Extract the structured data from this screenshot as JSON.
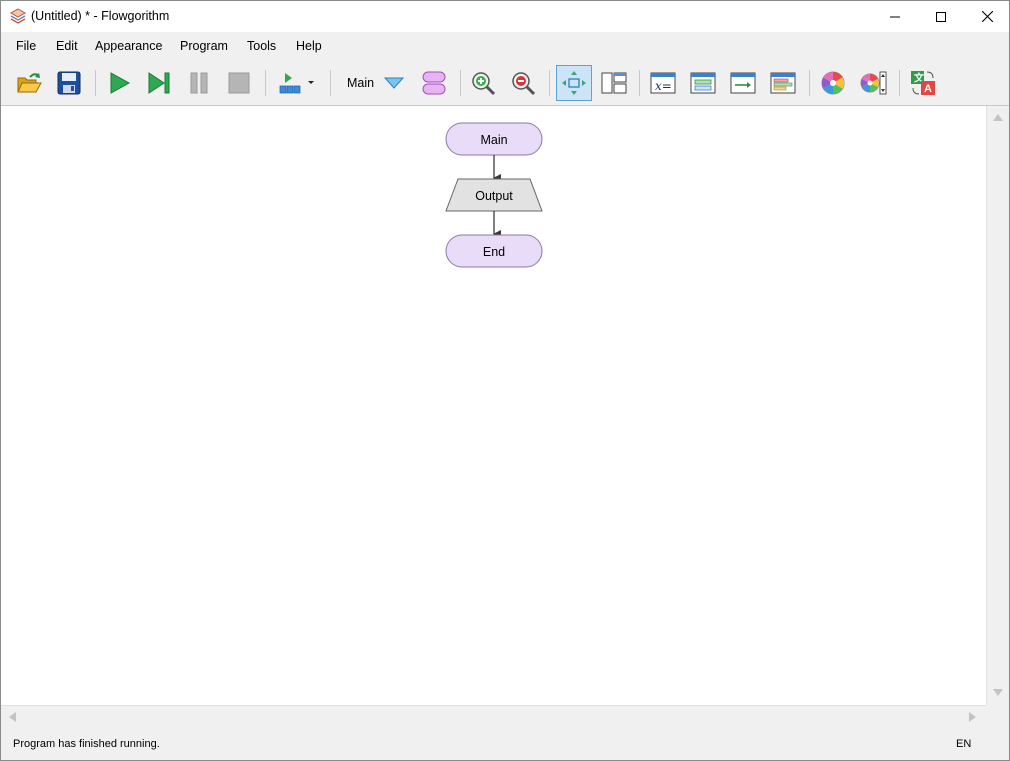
{
  "window": {
    "title": "(Untitled) * - Flowgorithm"
  },
  "menu": [
    "File",
    "Edit",
    "Appearance",
    "Program",
    "Tools",
    "Help"
  ],
  "toolbar": {
    "function_name": "Main",
    "buttons": [
      "open-icon",
      "save-icon",
      "run-icon",
      "step-icon",
      "pause-icon",
      "stop-icon",
      "run-speed-icon",
      "function-dropdown-icon",
      "manage-functions-icon",
      "zoom-in-icon",
      "zoom-out-icon",
      "center-layout-icon",
      "split-layout-icon",
      "variable-watch-icon",
      "console-icon",
      "source-code-icon",
      "layout-window-icon",
      "colors-icon",
      "color-scheme-icon",
      "language-icon"
    ]
  },
  "flowchart": {
    "start": "Main",
    "statements": [
      "Output"
    ],
    "end": "End"
  },
  "status": {
    "message": "Program has finished running.",
    "language": "EN"
  },
  "colors": {
    "terminal_fill": "#e9dcf9",
    "terminal_stroke": "#8a78a6",
    "output_fill": "#e2e2e2",
    "output_stroke": "#666666",
    "accent": "#5fa3d6"
  }
}
